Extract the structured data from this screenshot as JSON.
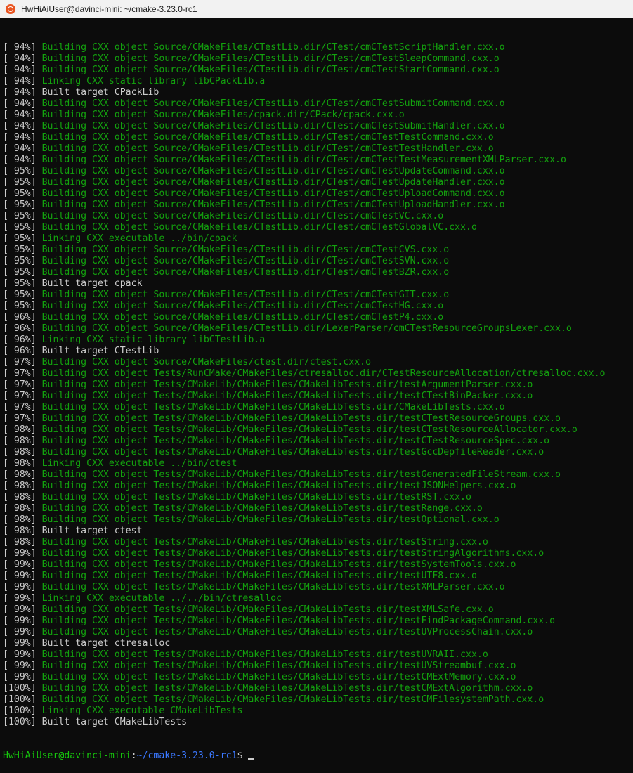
{
  "window": {
    "title": "HwHiAiUser@davinci-mini: ~/cmake-3.23.0-rc1"
  },
  "colors": {
    "background": "#0c0c0c",
    "build_green": "#13a10e",
    "text_gray": "#cccccc",
    "prompt_green": "#16c60c",
    "path_blue": "#3b78ff"
  },
  "terminal": {
    "lines": [
      {
        "pct": "[ 94%]",
        "msg": "Building CXX object Source/CMakeFiles/CTestLib.dir/CTest/cmCTestScriptHandler.cxx.o",
        "kind": "g"
      },
      {
        "pct": "[ 94%]",
        "msg": "Building CXX object Source/CMakeFiles/CTestLib.dir/CTest/cmCTestSleepCommand.cxx.o",
        "kind": "g"
      },
      {
        "pct": "[ 94%]",
        "msg": "Building CXX object Source/CMakeFiles/CTestLib.dir/CTest/cmCTestStartCommand.cxx.o",
        "kind": "g"
      },
      {
        "pct": "[ 94%]",
        "msg": "Linking CXX static library libCPackLib.a",
        "kind": "g"
      },
      {
        "pct": "[ 94%]",
        "msg": "Built target CPackLib",
        "kind": "w"
      },
      {
        "pct": "[ 94%]",
        "msg": "Building CXX object Source/CMakeFiles/CTestLib.dir/CTest/cmCTestSubmitCommand.cxx.o",
        "kind": "g"
      },
      {
        "pct": "[ 94%]",
        "msg": "Building CXX object Source/CMakeFiles/cpack.dir/CPack/cpack.cxx.o",
        "kind": "g"
      },
      {
        "pct": "[ 94%]",
        "msg": "Building CXX object Source/CMakeFiles/CTestLib.dir/CTest/cmCTestSubmitHandler.cxx.o",
        "kind": "g"
      },
      {
        "pct": "[ 94%]",
        "msg": "Building CXX object Source/CMakeFiles/CTestLib.dir/CTest/cmCTestTestCommand.cxx.o",
        "kind": "g"
      },
      {
        "pct": "[ 94%]",
        "msg": "Building CXX object Source/CMakeFiles/CTestLib.dir/CTest/cmCTestTestHandler.cxx.o",
        "kind": "g"
      },
      {
        "pct": "[ 94%]",
        "msg": "Building CXX object Source/CMakeFiles/CTestLib.dir/CTest/cmCTestTestMeasurementXMLParser.cxx.o",
        "kind": "g"
      },
      {
        "pct": "[ 95%]",
        "msg": "Building CXX object Source/CMakeFiles/CTestLib.dir/CTest/cmCTestUpdateCommand.cxx.o",
        "kind": "g"
      },
      {
        "pct": "[ 95%]",
        "msg": "Building CXX object Source/CMakeFiles/CTestLib.dir/CTest/cmCTestUpdateHandler.cxx.o",
        "kind": "g"
      },
      {
        "pct": "[ 95%]",
        "msg": "Building CXX object Source/CMakeFiles/CTestLib.dir/CTest/cmCTestUploadCommand.cxx.o",
        "kind": "g"
      },
      {
        "pct": "[ 95%]",
        "msg": "Building CXX object Source/CMakeFiles/CTestLib.dir/CTest/cmCTestUploadHandler.cxx.o",
        "kind": "g"
      },
      {
        "pct": "[ 95%]",
        "msg": "Building CXX object Source/CMakeFiles/CTestLib.dir/CTest/cmCTestVC.cxx.o",
        "kind": "g"
      },
      {
        "pct": "[ 95%]",
        "msg": "Building CXX object Source/CMakeFiles/CTestLib.dir/CTest/cmCTestGlobalVC.cxx.o",
        "kind": "g"
      },
      {
        "pct": "[ 95%]",
        "msg": "Linking CXX executable ../bin/cpack",
        "kind": "g"
      },
      {
        "pct": "[ 95%]",
        "msg": "Building CXX object Source/CMakeFiles/CTestLib.dir/CTest/cmCTestCVS.cxx.o",
        "kind": "g"
      },
      {
        "pct": "[ 95%]",
        "msg": "Building CXX object Source/CMakeFiles/CTestLib.dir/CTest/cmCTestSVN.cxx.o",
        "kind": "g"
      },
      {
        "pct": "[ 95%]",
        "msg": "Building CXX object Source/CMakeFiles/CTestLib.dir/CTest/cmCTestBZR.cxx.o",
        "kind": "g"
      },
      {
        "pct": "[ 95%]",
        "msg": "Built target cpack",
        "kind": "w"
      },
      {
        "pct": "[ 95%]",
        "msg": "Building CXX object Source/CMakeFiles/CTestLib.dir/CTest/cmCTestGIT.cxx.o",
        "kind": "g"
      },
      {
        "pct": "[ 95%]",
        "msg": "Building CXX object Source/CMakeFiles/CTestLib.dir/CTest/cmCTestHG.cxx.o",
        "kind": "g"
      },
      {
        "pct": "[ 96%]",
        "msg": "Building CXX object Source/CMakeFiles/CTestLib.dir/CTest/cmCTestP4.cxx.o",
        "kind": "g"
      },
      {
        "pct": "[ 96%]",
        "msg": "Building CXX object Source/CMakeFiles/CTestLib.dir/LexerParser/cmCTestResourceGroupsLexer.cxx.o",
        "kind": "g"
      },
      {
        "pct": "[ 96%]",
        "msg": "Linking CXX static library libCTestLib.a",
        "kind": "g"
      },
      {
        "pct": "[ 96%]",
        "msg": "Built target CTestLib",
        "kind": "w"
      },
      {
        "pct": "[ 97%]",
        "msg": "Building CXX object Source/CMakeFiles/ctest.dir/ctest.cxx.o",
        "kind": "g"
      },
      {
        "pct": "[ 97%]",
        "msg": "Building CXX object Tests/RunCMake/CMakeFiles/ctresalloc.dir/CTestResourceAllocation/ctresalloc.cxx.o",
        "kind": "g"
      },
      {
        "pct": "[ 97%]",
        "msg": "Building CXX object Tests/CMakeLib/CMakeFiles/CMakeLibTests.dir/testArgumentParser.cxx.o",
        "kind": "g"
      },
      {
        "pct": "[ 97%]",
        "msg": "Building CXX object Tests/CMakeLib/CMakeFiles/CMakeLibTests.dir/testCTestBinPacker.cxx.o",
        "kind": "g"
      },
      {
        "pct": "[ 97%]",
        "msg": "Building CXX object Tests/CMakeLib/CMakeFiles/CMakeLibTests.dir/CMakeLibTests.cxx.o",
        "kind": "g"
      },
      {
        "pct": "[ 97%]",
        "msg": "Building CXX object Tests/CMakeLib/CMakeFiles/CMakeLibTests.dir/testCTestResourceGroups.cxx.o",
        "kind": "g"
      },
      {
        "pct": "[ 98%]",
        "msg": "Building CXX object Tests/CMakeLib/CMakeFiles/CMakeLibTests.dir/testCTestResourceAllocator.cxx.o",
        "kind": "g"
      },
      {
        "pct": "[ 98%]",
        "msg": "Building CXX object Tests/CMakeLib/CMakeFiles/CMakeLibTests.dir/testCTestResourceSpec.cxx.o",
        "kind": "g"
      },
      {
        "pct": "[ 98%]",
        "msg": "Building CXX object Tests/CMakeLib/CMakeFiles/CMakeLibTests.dir/testGccDepfileReader.cxx.o",
        "kind": "g"
      },
      {
        "pct": "[ 98%]",
        "msg": "Linking CXX executable ../bin/ctest",
        "kind": "g"
      },
      {
        "pct": "[ 98%]",
        "msg": "Building CXX object Tests/CMakeLib/CMakeFiles/CMakeLibTests.dir/testGeneratedFileStream.cxx.o",
        "kind": "g"
      },
      {
        "pct": "[ 98%]",
        "msg": "Building CXX object Tests/CMakeLib/CMakeFiles/CMakeLibTests.dir/testJSONHelpers.cxx.o",
        "kind": "g"
      },
      {
        "pct": "[ 98%]",
        "msg": "Building CXX object Tests/CMakeLib/CMakeFiles/CMakeLibTests.dir/testRST.cxx.o",
        "kind": "g"
      },
      {
        "pct": "[ 98%]",
        "msg": "Building CXX object Tests/CMakeLib/CMakeFiles/CMakeLibTests.dir/testRange.cxx.o",
        "kind": "g"
      },
      {
        "pct": "[ 98%]",
        "msg": "Building CXX object Tests/CMakeLib/CMakeFiles/CMakeLibTests.dir/testOptional.cxx.o",
        "kind": "g"
      },
      {
        "pct": "[ 98%]",
        "msg": "Built target ctest",
        "kind": "w"
      },
      {
        "pct": "[ 98%]",
        "msg": "Building CXX object Tests/CMakeLib/CMakeFiles/CMakeLibTests.dir/testString.cxx.o",
        "kind": "g"
      },
      {
        "pct": "[ 99%]",
        "msg": "Building CXX object Tests/CMakeLib/CMakeFiles/CMakeLibTests.dir/testStringAlgorithms.cxx.o",
        "kind": "g"
      },
      {
        "pct": "[ 99%]",
        "msg": "Building CXX object Tests/CMakeLib/CMakeFiles/CMakeLibTests.dir/testSystemTools.cxx.o",
        "kind": "g"
      },
      {
        "pct": "[ 99%]",
        "msg": "Building CXX object Tests/CMakeLib/CMakeFiles/CMakeLibTests.dir/testUTF8.cxx.o",
        "kind": "g"
      },
      {
        "pct": "[ 99%]",
        "msg": "Building CXX object Tests/CMakeLib/CMakeFiles/CMakeLibTests.dir/testXMLParser.cxx.o",
        "kind": "g"
      },
      {
        "pct": "[ 99%]",
        "msg": "Linking CXX executable ../../bin/ctresalloc",
        "kind": "g"
      },
      {
        "pct": "[ 99%]",
        "msg": "Building CXX object Tests/CMakeLib/CMakeFiles/CMakeLibTests.dir/testXMLSafe.cxx.o",
        "kind": "g"
      },
      {
        "pct": "[ 99%]",
        "msg": "Building CXX object Tests/CMakeLib/CMakeFiles/CMakeLibTests.dir/testFindPackageCommand.cxx.o",
        "kind": "g"
      },
      {
        "pct": "[ 99%]",
        "msg": "Building CXX object Tests/CMakeLib/CMakeFiles/CMakeLibTests.dir/testUVProcessChain.cxx.o",
        "kind": "g"
      },
      {
        "pct": "[ 99%]",
        "msg": "Built target ctresalloc",
        "kind": "w"
      },
      {
        "pct": "[ 99%]",
        "msg": "Building CXX object Tests/CMakeLib/CMakeFiles/CMakeLibTests.dir/testUVRAII.cxx.o",
        "kind": "g"
      },
      {
        "pct": "[ 99%]",
        "msg": "Building CXX object Tests/CMakeLib/CMakeFiles/CMakeLibTests.dir/testUVStreambuf.cxx.o",
        "kind": "g"
      },
      {
        "pct": "[ 99%]",
        "msg": "Building CXX object Tests/CMakeLib/CMakeFiles/CMakeLibTests.dir/testCMExtMemory.cxx.o",
        "kind": "g"
      },
      {
        "pct": "[100%]",
        "msg": "Building CXX object Tests/CMakeLib/CMakeFiles/CMakeLibTests.dir/testCMExtAlgorithm.cxx.o",
        "kind": "g"
      },
      {
        "pct": "[100%]",
        "msg": "Building CXX object Tests/CMakeLib/CMakeFiles/CMakeLibTests.dir/testCMFilesystemPath.cxx.o",
        "kind": "g"
      },
      {
        "pct": "[100%]",
        "msg": "Linking CXX executable CMakeLibTests",
        "kind": "g"
      },
      {
        "pct": "[100%]",
        "msg": "Built target CMakeLibTests",
        "kind": "w"
      }
    ],
    "prompt": {
      "user_host": "HwHiAiUser@davinci-mini",
      "separator": ":",
      "path": "~/cmake-3.23.0-rc1",
      "symbol": "$"
    }
  }
}
